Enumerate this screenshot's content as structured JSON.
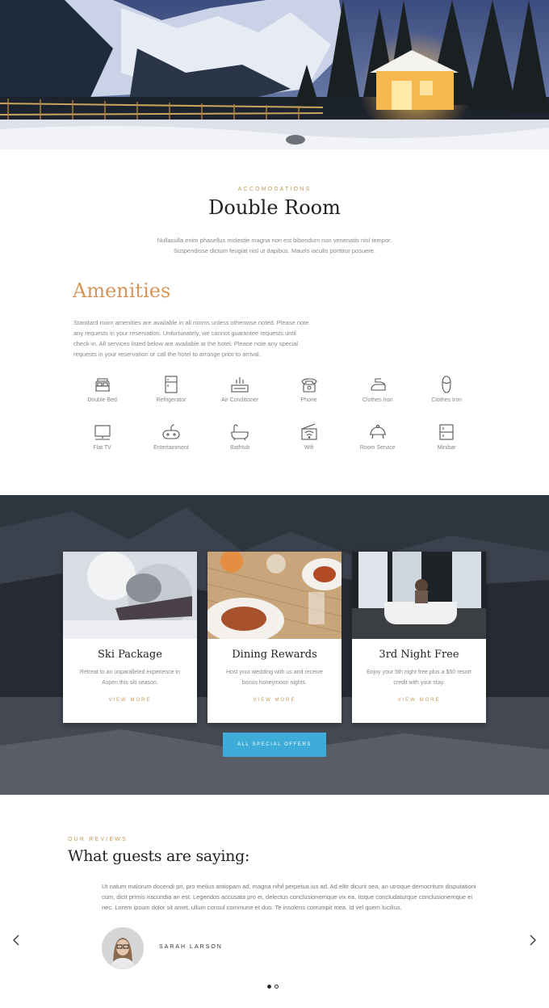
{
  "intro": {
    "eyebrow": "ACCOMODATIONS",
    "title": "Double Room",
    "text": "Nullasulla enim phasellus molestie magna non est bibendum non venenatis nisl tempor. Suspendisse dictum feugiat nisl ut dapibus. Mauris iaculis porttitor posuere."
  },
  "amenities": {
    "title": "Amenities",
    "text": "Standard room amenities are available in all rooms unless otherwise noted. Please note any requests in your reservation. Unfortunately, we cannot guarantee requests until check-in. All services listed below are available at the hotel. Please note any special requests in your reservation or call the hotel to arrange prior to arrival.",
    "items": [
      {
        "label": "Double Bed",
        "icon": "bed-icon"
      },
      {
        "label": "Refrigerator",
        "icon": "refrigerator-icon"
      },
      {
        "label": "Air Conditioner",
        "icon": "air-conditioner-icon"
      },
      {
        "label": "Phone",
        "icon": "phone-icon"
      },
      {
        "label": "Clothes Iron",
        "icon": "iron-icon"
      },
      {
        "label": "Clothes Iron",
        "icon": "slipper-icon"
      },
      {
        "label": "Flat TV",
        "icon": "tv-icon"
      },
      {
        "label": "Entertainment",
        "icon": "gamepad-icon"
      },
      {
        "label": "Bathtub",
        "icon": "bathtub-icon"
      },
      {
        "label": "Wifi",
        "icon": "wifi-icon"
      },
      {
        "label": "Room Service",
        "icon": "cloche-icon"
      },
      {
        "label": "Minibar",
        "icon": "minibar-icon"
      }
    ]
  },
  "offers": {
    "cards": [
      {
        "title": "Ski Package",
        "text": "Retreat to an unparalleled experience in Aspen this ski season.",
        "link": "VIEW MORE"
      },
      {
        "title": "Dining Rewards",
        "text": "Host your wedding with us and receive bonus honeymoon nights.",
        "link": "VIEW MORE"
      },
      {
        "title": "3rd Night Free",
        "text": "Enjoy your 5th night free plus a $50 resort credit with your stay.",
        "link": "VIEW MORE"
      }
    ],
    "button": "ALL SPECIAL OFFERS"
  },
  "reviews": {
    "eyebrow": "OUR REVIEWS",
    "title": "What guests are saying:",
    "text": "Ut natum malorum docendi pri, pro melius antiopam ad, magna nihil perpetua ius ad. Ad elitr dicunt sea, an utroque democritum disputationi cum, dicit primis iracundia an est. Legendos accusata pro ei, delectus conclusionemque vix ea. Iisque concludaturque conclusionemque ei nec. Lorem ipsum dolor sit amet, ullum consul commune et duo. Te insolens corrumpit mea. Id vel quem lucilius.",
    "name": "SARAH LARSON"
  },
  "colors": {
    "accent": "#c8995a",
    "amenities_title": "#d4955a",
    "button": "#3eacd9"
  }
}
